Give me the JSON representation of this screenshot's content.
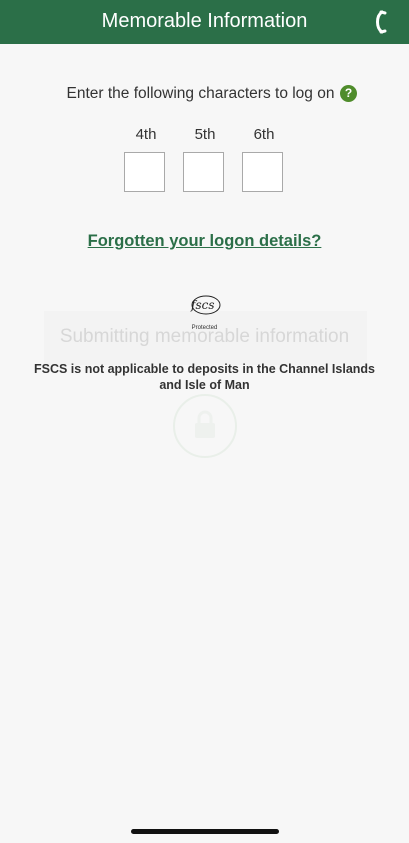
{
  "header": {
    "title": "Memorable Information",
    "call_icon": "phone-icon"
  },
  "instruction": {
    "text": "Enter the following characters to log on",
    "help_glyph": "?"
  },
  "characters": [
    {
      "label": "4th",
      "value": ""
    },
    {
      "label": "5th",
      "value": ""
    },
    {
      "label": "6th",
      "value": ""
    }
  ],
  "forgot_link": "Forgotten your logon details?",
  "overlay": {
    "text": "Submitting memorable information",
    "icon": "lock-icon"
  },
  "fscs": {
    "logo_text": "fscs",
    "protected": "Protected",
    "note": "FSCS is not applicable to deposits in the Channel Islands and Isle of Man"
  },
  "colors": {
    "brand_green": "#2b6f48",
    "help_green": "#4f8c2b"
  }
}
